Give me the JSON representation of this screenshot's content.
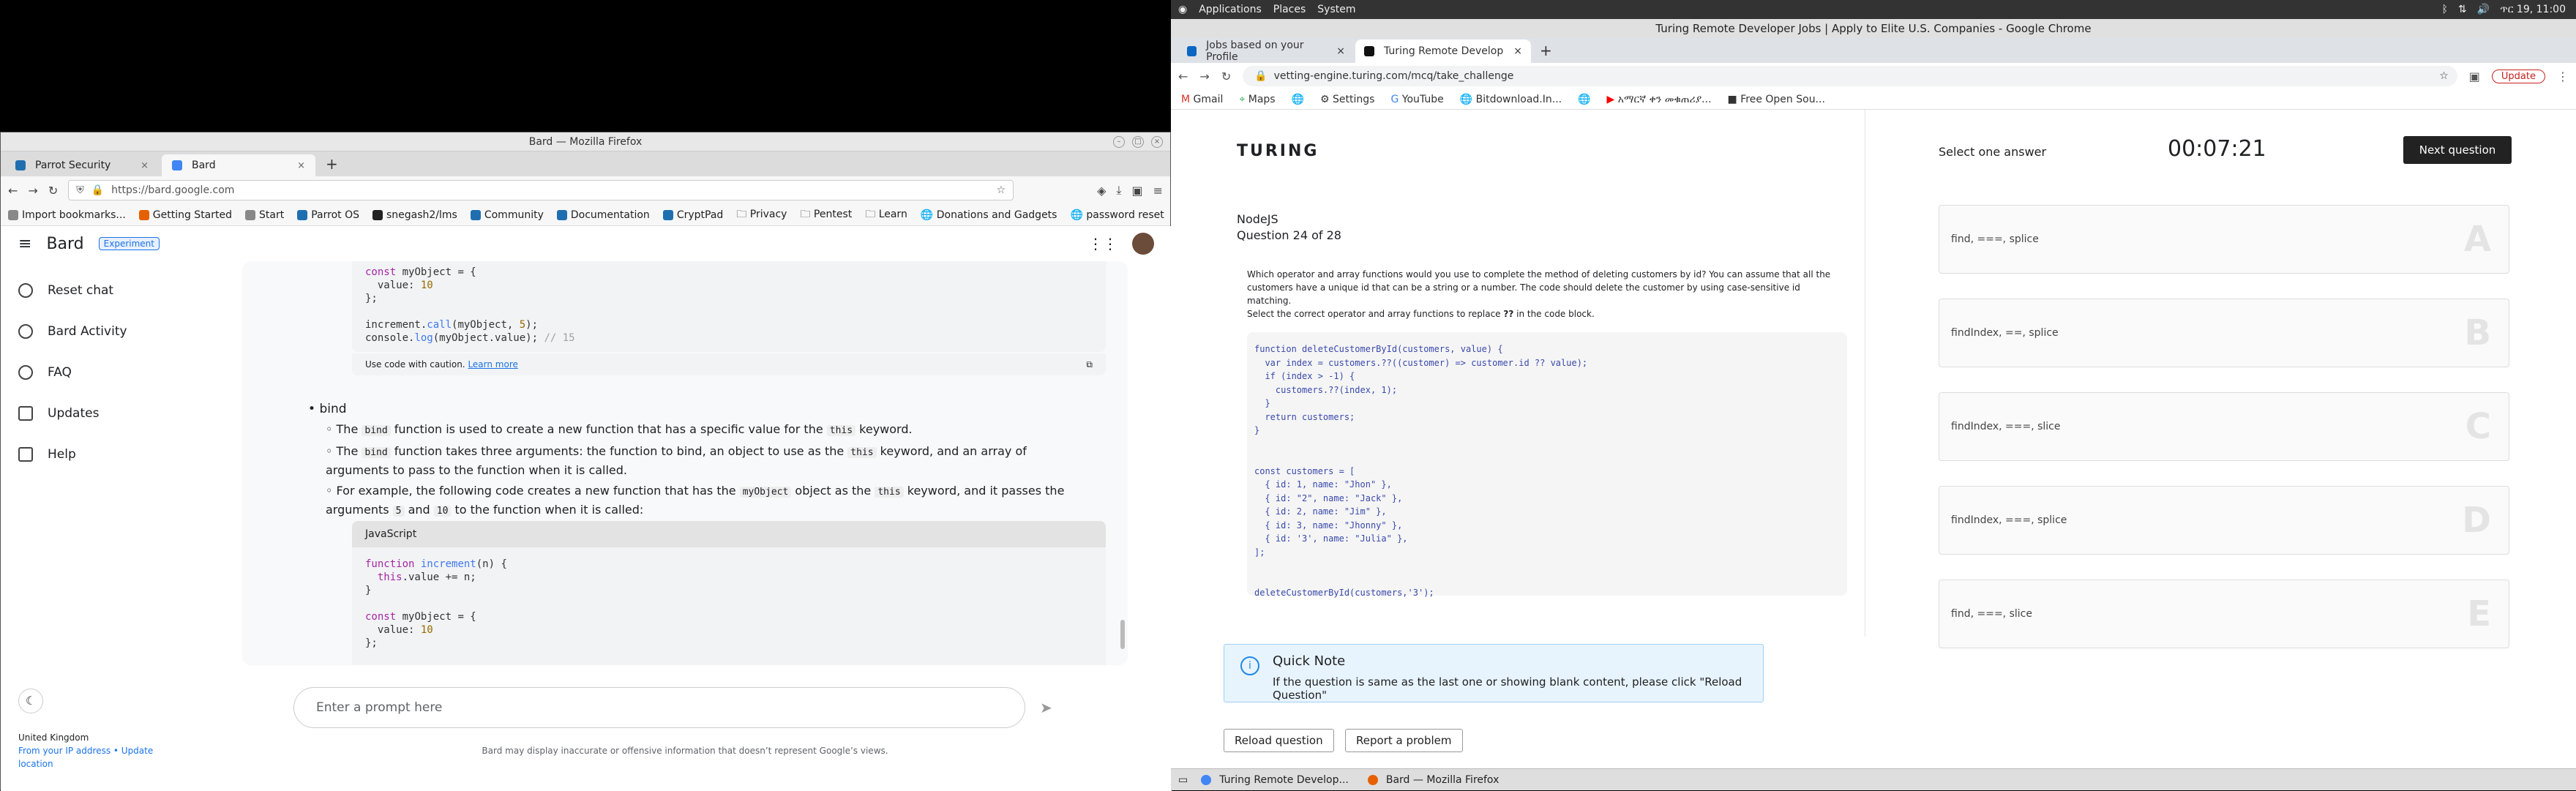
{
  "firefox": {
    "window_title": "Bard — Mozilla Firefox",
    "tabs": [
      {
        "label": "Parrot Security"
      },
      {
        "label": "Bard"
      }
    ],
    "url": "https://bard.google.com",
    "bookmarks": [
      "Import bookmarks...",
      "Getting Started",
      "Start",
      "Parrot OS",
      "snegash2/lms",
      "Community",
      "Documentation",
      "CryptPad",
      "Privacy",
      "Pentest",
      "Learn",
      "Donations and Gadgets",
      "password reset"
    ]
  },
  "bard": {
    "logo": "Bard",
    "badge": "Experiment",
    "sidebar": [
      {
        "label": "Reset chat",
        "icon": "reset-icon"
      },
      {
        "label": "Bard Activity",
        "icon": "history-icon"
      },
      {
        "label": "FAQ",
        "icon": "help-circle-icon"
      },
      {
        "label": "Updates",
        "icon": "calendar-icon"
      },
      {
        "label": "Help",
        "icon": "chat-help-icon"
      }
    ],
    "location": {
      "country": "United Kingdom",
      "link": "From your IP address • Update location"
    },
    "caution_text": "Use code with caution.",
    "learn_more": "Learn more",
    "section_title": "bind",
    "bullets": {
      "b1_a": "The ",
      "b1_code": "bind",
      "b1_b": " function is used to create a new function that has a specific value for the ",
      "b1_code2": "this",
      "b1_c": " keyword.",
      "b2_a": "The ",
      "b2_code": "bind",
      "b2_b": " function takes three arguments: the function to bind, an object to use as the ",
      "b2_code2": "this",
      "b2_c": " keyword, and an array of arguments to pass to the function when it is called.",
      "b3_a": "For example, the following code creates a new function that has the ",
      "b3_code": "myObject",
      "b3_b": " object as the ",
      "b3_code2": "this",
      "b3_c": " keyword, and it passes the arguments ",
      "b3_code3": "5",
      "b3_d": " and ",
      "b3_code4": "10",
      "b3_e": " to the function when it is called:"
    },
    "code_lang": "JavaScript",
    "prompt_placeholder": "Enter a prompt here",
    "disclaimer": "Bard may display inaccurate or offensive information that doesn’t represent Google’s views."
  },
  "system": {
    "menu": [
      "Applications",
      "Places",
      "System"
    ],
    "clock": "ጥር 19, 11:00"
  },
  "chrome": {
    "window_title": "Turing Remote Developer Jobs | Apply to Elite U.S. Companies - Google Chrome",
    "tabs": [
      {
        "label": "Jobs based on your Profile"
      },
      {
        "label": "Turing Remote Develop"
      }
    ],
    "url": "vetting-engine.turing.com/mcq/take_challenge",
    "update_label": "Update",
    "bookmarks": [
      "Gmail",
      "Maps",
      "Settings",
      "YouTube",
      "Bitdownload.In...",
      "አማርኛ ቀን መቁጠሪያ...",
      "Free Open Sou..."
    ]
  },
  "turing": {
    "logo": "TURING",
    "subject": "NodeJS",
    "question_num": "Question 24 of 28",
    "question_text": "Which operator and array functions would you use to complete the method of deleting customers by id? You can assume that all the customers have a unique id that can be a string or a number. The code should delete the customer by using case-sensitive id matching.",
    "instruction_a": "Select the correct operator and array functions to replace ",
    "instruction_b": "??",
    "instruction_c": " in the code block.",
    "select_label": "Select one answer",
    "timer": "00:07:21",
    "next_label": "Next question",
    "options": [
      {
        "letter": "A",
        "text": "find, ===, splice"
      },
      {
        "letter": "B",
        "text": "findIndex, ==, splice"
      },
      {
        "letter": "C",
        "text": "findIndex, ===, slice"
      },
      {
        "letter": "D",
        "text": "findIndex, ===, splice"
      },
      {
        "letter": "E",
        "text": "find, ===, slice"
      }
    ],
    "note_title": "Quick Note",
    "note_text": "If the question is same as the last one or showing blank content, please click \"Reload Question\"",
    "reload_label": "Reload question",
    "report_label": "Report a problem"
  },
  "taskbar": [
    "Turing Remote Develop...",
    "Bard — Mozilla Firefox"
  ]
}
